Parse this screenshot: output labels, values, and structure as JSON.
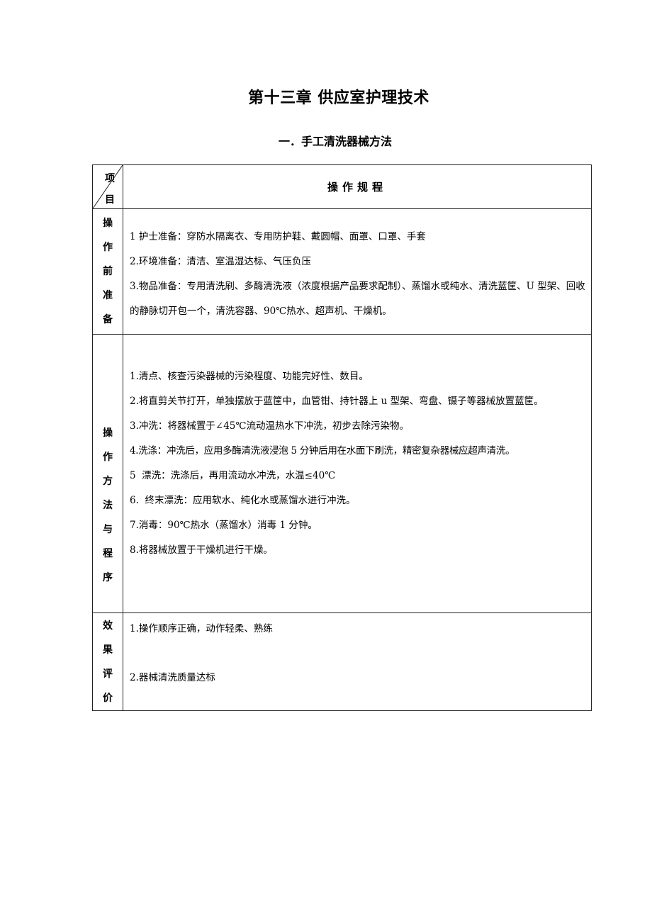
{
  "document": {
    "title": "第十三章  供应室护理技术",
    "subtitle": "一．手工清洗器械方法"
  },
  "table": {
    "header": {
      "diag_top": "项",
      "diag_bottom": "目",
      "main": "操作规程"
    },
    "rows": [
      {
        "label_chars": [
          "操",
          "作",
          "前",
          "准",
          "备"
        ],
        "items": [
          "1 护士准备：穿防水隔离衣、专用防护鞋、戴圆帽、面罩、口罩、手套",
          "2.环境准备：清洁、室温湿达标、气压负压",
          "3.物品准备：专用清洗刷、多酶清洗液（浓度根据产品要求配制）、蒸馏水或纯水、清洗蓝筐、U 型架、回收的静脉切开包一个，清洗容器、90℃热水、超声机、干燥机。"
        ]
      },
      {
        "label_chars": [
          "操",
          "作",
          "方",
          "法",
          "与",
          "程",
          "序"
        ],
        "items": [
          "1.清点、核查污染器械的污染程度、功能完好性、数目。",
          "2.将直剪关节打开，单独摆放于蓝筐中，血管钳、持针器上 u 型架、弯盘、镊子等器械放置蓝筐。",
          "3.冲洗：将器械置于∠45℃流动温热水下冲洗，初步去除污染物。",
          "4.洗涤：冲洗后，应用多酶清洗液浸泡 5 分钟后用在水面下刷洗，精密复杂器械应超声清洗。",
          "5  漂洗：洗涤后，再用流动水冲洗，水温≤40℃",
          "6.  终末漂洗：应用软水、纯化水或蒸馏水进行冲洗。",
          "7.消毒：90℃热水（蒸馏水）消毒 1 分钟。",
          "8.将器械放置于干燥机进行干燥。"
        ]
      },
      {
        "label_chars": [
          "效",
          "果",
          "评",
          "价"
        ],
        "items": [
          "1.操作顺序正确，动作轻柔、熟练",
          "2.器械清洗质量达标"
        ]
      }
    ]
  }
}
